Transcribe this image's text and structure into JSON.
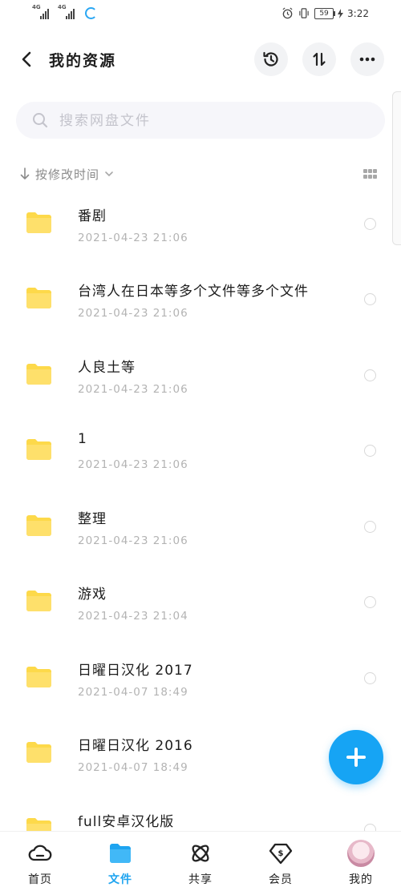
{
  "status": {
    "sim1": "4G",
    "sim2": "4G",
    "battery": "59",
    "time": "3:22"
  },
  "header": {
    "title": "我的资源"
  },
  "search": {
    "placeholder": "搜索网盘文件"
  },
  "sort": {
    "label": "按修改时间"
  },
  "files": [
    {
      "name": "番剧",
      "date": "2021-04-23  21:06"
    },
    {
      "name": "台湾人在日本等多个文件等多个文件",
      "date": "2021-04-23  21:06"
    },
    {
      "name": "人良土等",
      "date": "2021-04-23  21:06"
    },
    {
      "name": "1",
      "date": "2021-04-23  21:06"
    },
    {
      "name": "整理",
      "date": "2021-04-23  21:06"
    },
    {
      "name": "游戏",
      "date": "2021-04-23  21:04"
    },
    {
      "name": "日曜日汉化 2017",
      "date": "2021-04-07  18:49"
    },
    {
      "name": "日曜日汉化 2016",
      "date": "2021-04-07  18:49"
    },
    {
      "name": "full安卓汉化版",
      "date": ""
    }
  ],
  "nav": [
    {
      "label": "首页",
      "icon": "cloud-icon"
    },
    {
      "label": "文件",
      "icon": "folder-icon"
    },
    {
      "label": "共享",
      "icon": "share-atom-icon"
    },
    {
      "label": "会员",
      "icon": "vip-diamond-icon"
    },
    {
      "label": "我的",
      "icon": "avatar"
    }
  ],
  "colors": {
    "accent": "#1ea4f0",
    "folder": "#fdd94a",
    "fab": "#16a4f4"
  }
}
